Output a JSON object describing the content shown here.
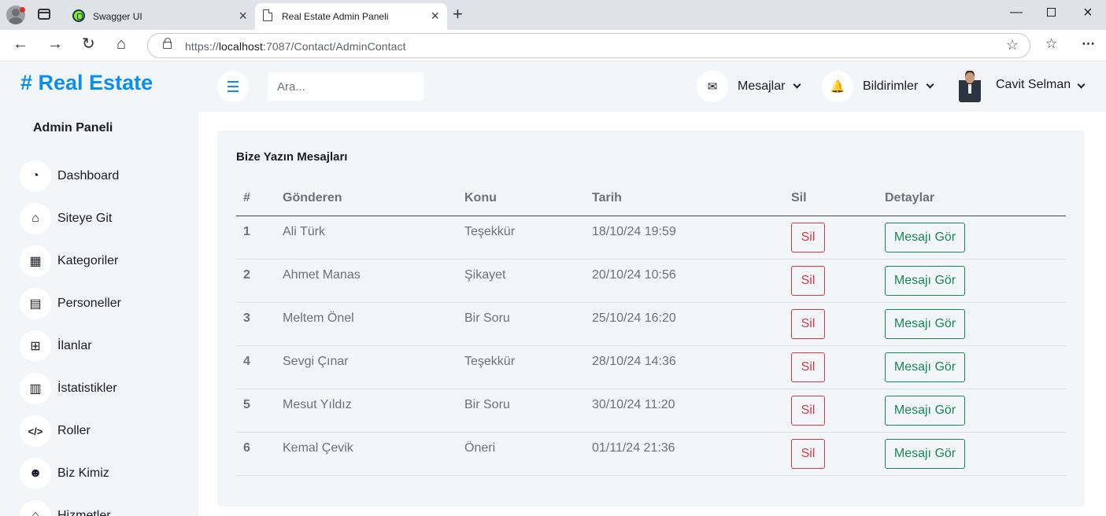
{
  "browser": {
    "tabs": [
      {
        "title": "Swagger UI",
        "icon": "swagger-favicon-icon",
        "active": false
      },
      {
        "title": "Real Estate Admin Paneli",
        "icon": "page-icon",
        "active": true
      }
    ],
    "url_prefix": "https://",
    "url_host": "localhost",
    "url_rest": ":7087/Contact/AdminContact"
  },
  "sidebar": {
    "brand": "# Real Estate",
    "heading": "Admin Paneli",
    "items": [
      {
        "label": "Dashboard",
        "icon": "dashboard-gauge-icon",
        "glyph": "◔"
      },
      {
        "label": "Siteye Git",
        "icon": "home-icon",
        "glyph": "⌂"
      },
      {
        "label": "Kategoriler",
        "icon": "grid-icon",
        "glyph": "▦"
      },
      {
        "label": "Personeller",
        "icon": "id-card-icon",
        "glyph": "▤"
      },
      {
        "label": "İlanlar",
        "icon": "table-icon",
        "glyph": "⊞"
      },
      {
        "label": "İstatistikler",
        "icon": "bar-chart-icon",
        "glyph": "▥"
      },
      {
        "label": "Roller",
        "icon": "code-icon",
        "glyph": "</>"
      },
      {
        "label": "Biz Kimiz",
        "icon": "users-icon",
        "glyph": "☻"
      },
      {
        "label": "Hizmetler",
        "icon": "building-icon",
        "glyph": "⌂"
      }
    ]
  },
  "topnav": {
    "search_placeholder": "Ara...",
    "messages_label": "Mesajlar",
    "notifications_label": "Bildirimler",
    "user_name": "Cavit Selman"
  },
  "card": {
    "title": "Bize Yazın Mesajları",
    "columns": [
      "#",
      "Gönderen",
      "Konu",
      "Tarih",
      "Sil",
      "Detaylar"
    ],
    "delete_label": "Sil",
    "detail_label": "Mesajı Gör",
    "rows": [
      {
        "id": "1",
        "sender": "Ali Türk",
        "subject": "Teşekkür",
        "date": "18/10/24 19:59"
      },
      {
        "id": "2",
        "sender": "Ahmet Manas",
        "subject": "Şikayet",
        "date": "20/10/24 10:56"
      },
      {
        "id": "3",
        "sender": "Meltem Önel",
        "subject": "Bir Soru",
        "date": "25/10/24 16:20"
      },
      {
        "id": "4",
        "sender": "Sevgi Çınar",
        "subject": "Teşekkür",
        "date": "28/10/24 14:36"
      },
      {
        "id": "5",
        "sender": "Mesut Yıldız",
        "subject": "Bir Soru",
        "date": "30/10/24 11:20"
      },
      {
        "id": "6",
        "sender": "Kemal Çevik",
        "subject": "Öneri",
        "date": "01/11/24 21:36"
      }
    ]
  },
  "colors": {
    "brand": "#0d8ee8",
    "sidebar_bg": "#f3f6f9",
    "danger": "#dc3545",
    "success": "#198754"
  }
}
